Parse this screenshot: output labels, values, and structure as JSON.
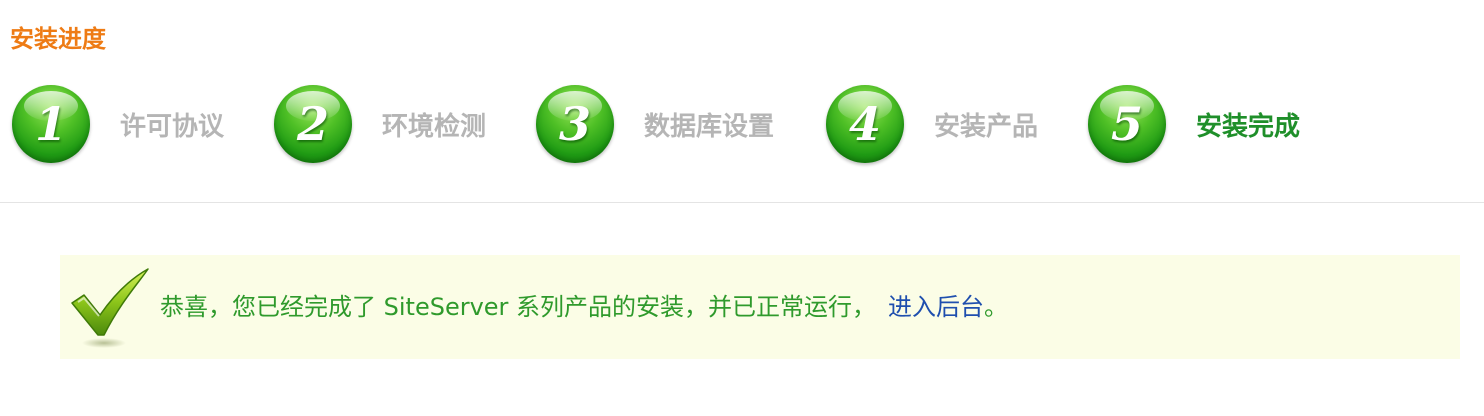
{
  "progress": {
    "title": "安装进度",
    "steps": [
      {
        "number": "1",
        "label": "许可协议",
        "active": false
      },
      {
        "number": "2",
        "label": "环境检测",
        "active": false
      },
      {
        "number": "3",
        "label": "数据库设置",
        "active": false
      },
      {
        "number": "4",
        "label": "安装产品",
        "active": false
      },
      {
        "number": "5",
        "label": "安装完成",
        "active": true
      }
    ]
  },
  "notice": {
    "icon": "checkmark-icon",
    "message": "恭喜，您已经完成了 SiteServer 系列产品的安装，并已正常运行，",
    "link_text": "进入后台",
    "suffix": "。"
  },
  "colors": {
    "title": "#ee7b14",
    "active_step": "#1f8f2a",
    "inactive_step": "#b5b5b5",
    "notice_background": "#fbfde6",
    "notice_text": "#2f9a2c",
    "link": "#1f4fae"
  }
}
